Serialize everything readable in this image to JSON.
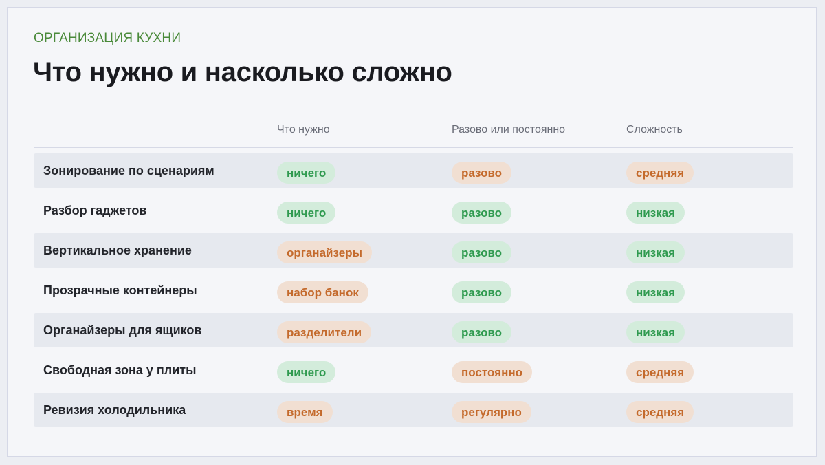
{
  "header": {
    "eyebrow": "ОРГАНИЗАЦИЯ КУХНИ",
    "title": "Что нужно и насколько сложно"
  },
  "table": {
    "columns": [
      "",
      "Что нужно",
      "Разово или постоянно",
      "Сложность"
    ],
    "rows": [
      {
        "label": "Зонирование по сценариям",
        "shaded": true,
        "cells": [
          {
            "text": "ничего",
            "tone": "green"
          },
          {
            "text": "разово",
            "tone": "orange"
          },
          {
            "text": "средняя",
            "tone": "orange"
          }
        ]
      },
      {
        "label": "Разбор гаджетов",
        "shaded": false,
        "cells": [
          {
            "text": "ничего",
            "tone": "green"
          },
          {
            "text": "разово",
            "tone": "green"
          },
          {
            "text": "низкая",
            "tone": "green"
          }
        ]
      },
      {
        "label": "Вертикальное хранение",
        "shaded": true,
        "cells": [
          {
            "text": "органайзеры",
            "tone": "orange"
          },
          {
            "text": "разово",
            "tone": "green"
          },
          {
            "text": "низкая",
            "tone": "green"
          }
        ]
      },
      {
        "label": "Прозрачные контейнеры",
        "shaded": false,
        "cells": [
          {
            "text": "набор банок",
            "tone": "orange"
          },
          {
            "text": "разово",
            "tone": "green"
          },
          {
            "text": "низкая",
            "tone": "green"
          }
        ]
      },
      {
        "label": "Органайзеры для ящиков",
        "shaded": true,
        "cells": [
          {
            "text": "разделители",
            "tone": "orange"
          },
          {
            "text": "разово",
            "tone": "green"
          },
          {
            "text": "низкая",
            "tone": "green"
          }
        ]
      },
      {
        "label": "Свободная зона у плиты",
        "shaded": false,
        "cells": [
          {
            "text": "ничего",
            "tone": "green"
          },
          {
            "text": "постоянно",
            "tone": "orange"
          },
          {
            "text": "средняя",
            "tone": "orange"
          }
        ]
      },
      {
        "label": "Ревизия холодильника",
        "shaded": true,
        "cells": [
          {
            "text": "время",
            "tone": "orange"
          },
          {
            "text": "регулярно",
            "tone": "orange"
          },
          {
            "text": "средняя",
            "tone": "orange"
          }
        ]
      }
    ]
  },
  "colors": {
    "accent_green": "#2f9a4f",
    "pill_green_bg": "#d3ecdb",
    "accent_orange": "#c46a2c",
    "pill_orange_bg": "#f1dfd2",
    "eyebrow": "#4a8a3a"
  }
}
